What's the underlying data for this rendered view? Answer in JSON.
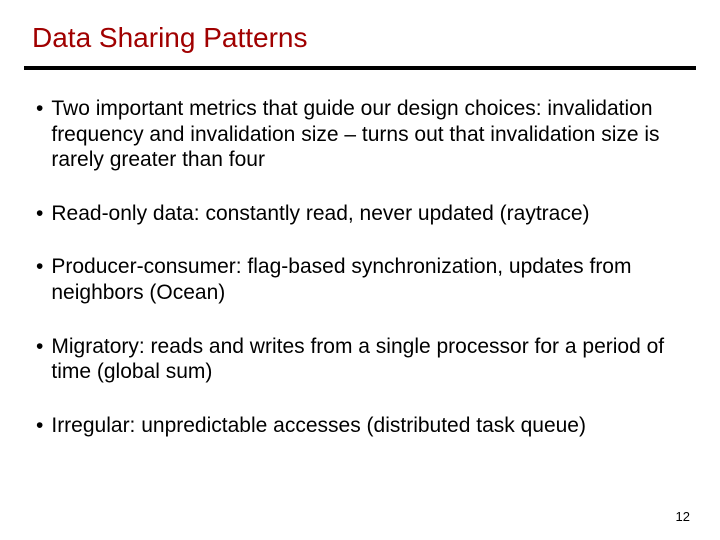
{
  "title": "Data Sharing Patterns",
  "bullets": [
    "Two important metrics that guide our design choices: invalidation frequency and invalidation size – turns out that invalidation size is rarely greater than four",
    "Read-only data: constantly read, never updated (raytrace)",
    "Producer-consumer: flag-based synchronization, updates from neighbors (Ocean)",
    "Migratory: reads and writes from a single processor for a period of time (global sum)",
    "Irregular: unpredictable accesses (distributed task queue)"
  ],
  "page_number": "12"
}
